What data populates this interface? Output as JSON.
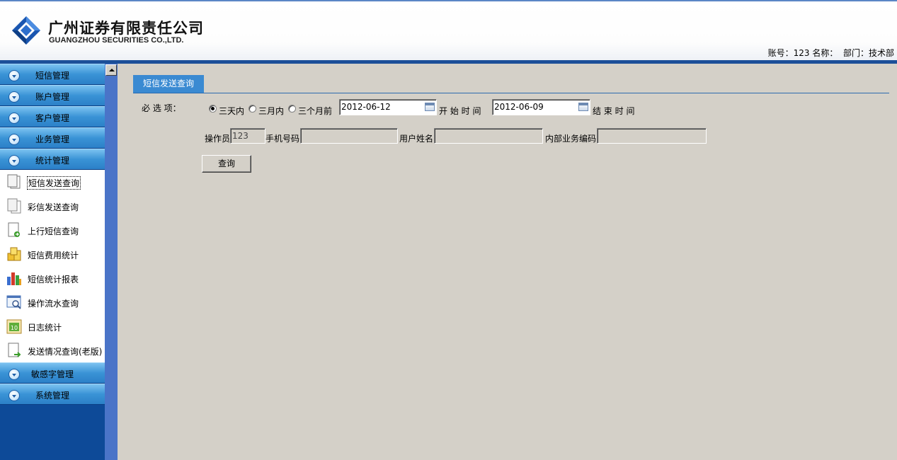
{
  "header": {
    "company_cn": "广州证券有限责任公司",
    "company_en": "GUANGZHOU SECURITIES CO.,LTD.",
    "account_label": "账号：",
    "account_value": "123",
    "name_label": "名称：",
    "name_value": "",
    "dept_label": "部门：",
    "dept_value": "技术部"
  },
  "sidebar": {
    "menus_top": [
      {
        "label": "短信管理"
      },
      {
        "label": "账户管理"
      },
      {
        "label": "客户管理"
      },
      {
        "label": "业务管理"
      },
      {
        "label": "统计管理"
      }
    ],
    "submenu": [
      {
        "label": "短信发送查询",
        "icon": "document-copy-icon"
      },
      {
        "label": "彩信发送查询",
        "icon": "documents-icon"
      },
      {
        "label": "上行短信查询",
        "icon": "document-arrow-icon"
      },
      {
        "label": "短信费用统计",
        "icon": "coins-icon"
      },
      {
        "label": "短信统计报表",
        "icon": "bar-chart-icon"
      },
      {
        "label": "操作流水查询",
        "icon": "magnifier-window-icon"
      },
      {
        "label": "日志统计",
        "icon": "calendar-icon"
      },
      {
        "label": "发送情况查询(老版)",
        "icon": "document-send-icon"
      }
    ],
    "menus_bottom": [
      {
        "label": "敏感字管理"
      },
      {
        "label": "系统管理"
      }
    ]
  },
  "content": {
    "tab_label": "短信发送查询",
    "required_label": "必 选 项：",
    "radio_options": [
      {
        "label": "三天内",
        "checked": true
      },
      {
        "label": "三月内",
        "checked": false
      },
      {
        "label": "三个月前",
        "checked": false
      }
    ],
    "start_date": "2012-06-12",
    "start_label": "开 始 时 间",
    "end_date": "2012-06-09",
    "end_label": "结 束 时 间",
    "operator_label": "操作员",
    "operator_value": "123",
    "phone_label": "手机号码",
    "phone_value": "",
    "username_label": "用户姓名",
    "username_value": "",
    "bizcode_label": "内部业务编码",
    "bizcode_value": "",
    "query_button": "查询"
  },
  "colors": {
    "brand_blue": "#1c4f99",
    "sidebar_bg": "#0d4a98",
    "tab_bg": "#3a8ad2",
    "panel_bg": "#d4d0c8"
  }
}
